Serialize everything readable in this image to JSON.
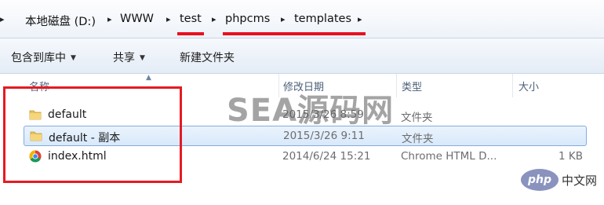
{
  "breadcrumb": {
    "items": [
      "本地磁盘 (D:)",
      "WWW",
      "test",
      "phpcms",
      "templates"
    ]
  },
  "toolbar": {
    "organize_label": "包含到库中",
    "share_label": "共享",
    "new_folder_label": "新建文件夹"
  },
  "columns": {
    "name": "名称",
    "date": "修改日期",
    "type": "类型",
    "size": "大小"
  },
  "files": [
    {
      "name": "default",
      "date": "2015/3/26 8:59",
      "type": "文件夹",
      "size": "",
      "icon": "folder-icon"
    },
    {
      "name": "default - 副本",
      "date": "2015/3/26 9:11",
      "type": "文件夹",
      "size": "",
      "icon": "folder-icon",
      "selected": true
    },
    {
      "name": "index.html",
      "date": "2014/6/24 15:21",
      "type": "Chrome HTML D...",
      "size": "1 KB",
      "icon": "chrome-icon"
    }
  ],
  "watermark": "SEA源码网",
  "logo": {
    "badge": "php",
    "text": "中文网"
  },
  "colors": {
    "highlight_red": "#e8101f",
    "selection_border": "#84acdd",
    "header_text": "#4c607a"
  }
}
